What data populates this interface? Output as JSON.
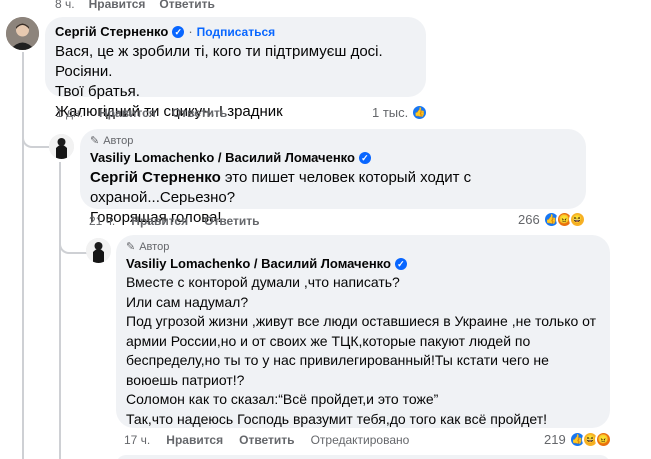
{
  "top_actions": {
    "time": "8 ч.",
    "like": "Нравится",
    "reply": "Ответить"
  },
  "comments": [
    {
      "author": "Сергій Стерненко",
      "follow": "Подписаться",
      "lines": [
        "Вася, це ж зробили ті, кого ти підтримуєш досі. Росіяни.",
        "Твої братья.",
        "Жалюгідний ти сцикун. І зрадник"
      ],
      "time": "1 дн.",
      "like": "Нравится",
      "reply": "Ответить",
      "reaction_count": "1 тыс."
    },
    {
      "badge": "Автор",
      "author": "Vasiliy Lomachenko / Василий Ломаченко",
      "mention": "Сергій Стерненко",
      "line1_rest": " это пишет человек который ходит с охраной...Серьезно?",
      "line2": "Говорящая голова!",
      "time": "21 ч.",
      "like": "Нравится",
      "reply": "Ответить",
      "reaction_count": "266"
    },
    {
      "badge": "Автор",
      "author": "Vasiliy Lomachenko / Василий Ломаченко",
      "lines": [
        "Вместе с конторой думали ,что написать?",
        "Или сам надумал?",
        "Под угрозой жизни ,живут все люди оставшиеся в Украине ,не только от",
        "армии России,но и от своих же ТЦК,которые пакуют людей по",
        "беспределу,но ты то у нас привилегированный!Ты кстати чего не",
        "воюешь патриот!?",
        "Соломон как то сказал:“Всё пройдет,и это тоже”",
        "Так,что надеюсь Господь вразумит тебя,до того как всё пройдет!"
      ],
      "time": "17 ч.",
      "like": "Нравится",
      "reply": "Ответить",
      "edited": "Отредактировано",
      "reaction_count": "219"
    }
  ],
  "colors": {
    "bubble": "#f0f2f5",
    "accent": "#0866ff",
    "meta": "#65676b",
    "thread": "#ced0d4"
  },
  "icons": [
    "verified-badge-icon",
    "pencil-icon",
    "like-reaction-icon",
    "angry-reaction-icon",
    "haha-reaction-icon"
  ]
}
